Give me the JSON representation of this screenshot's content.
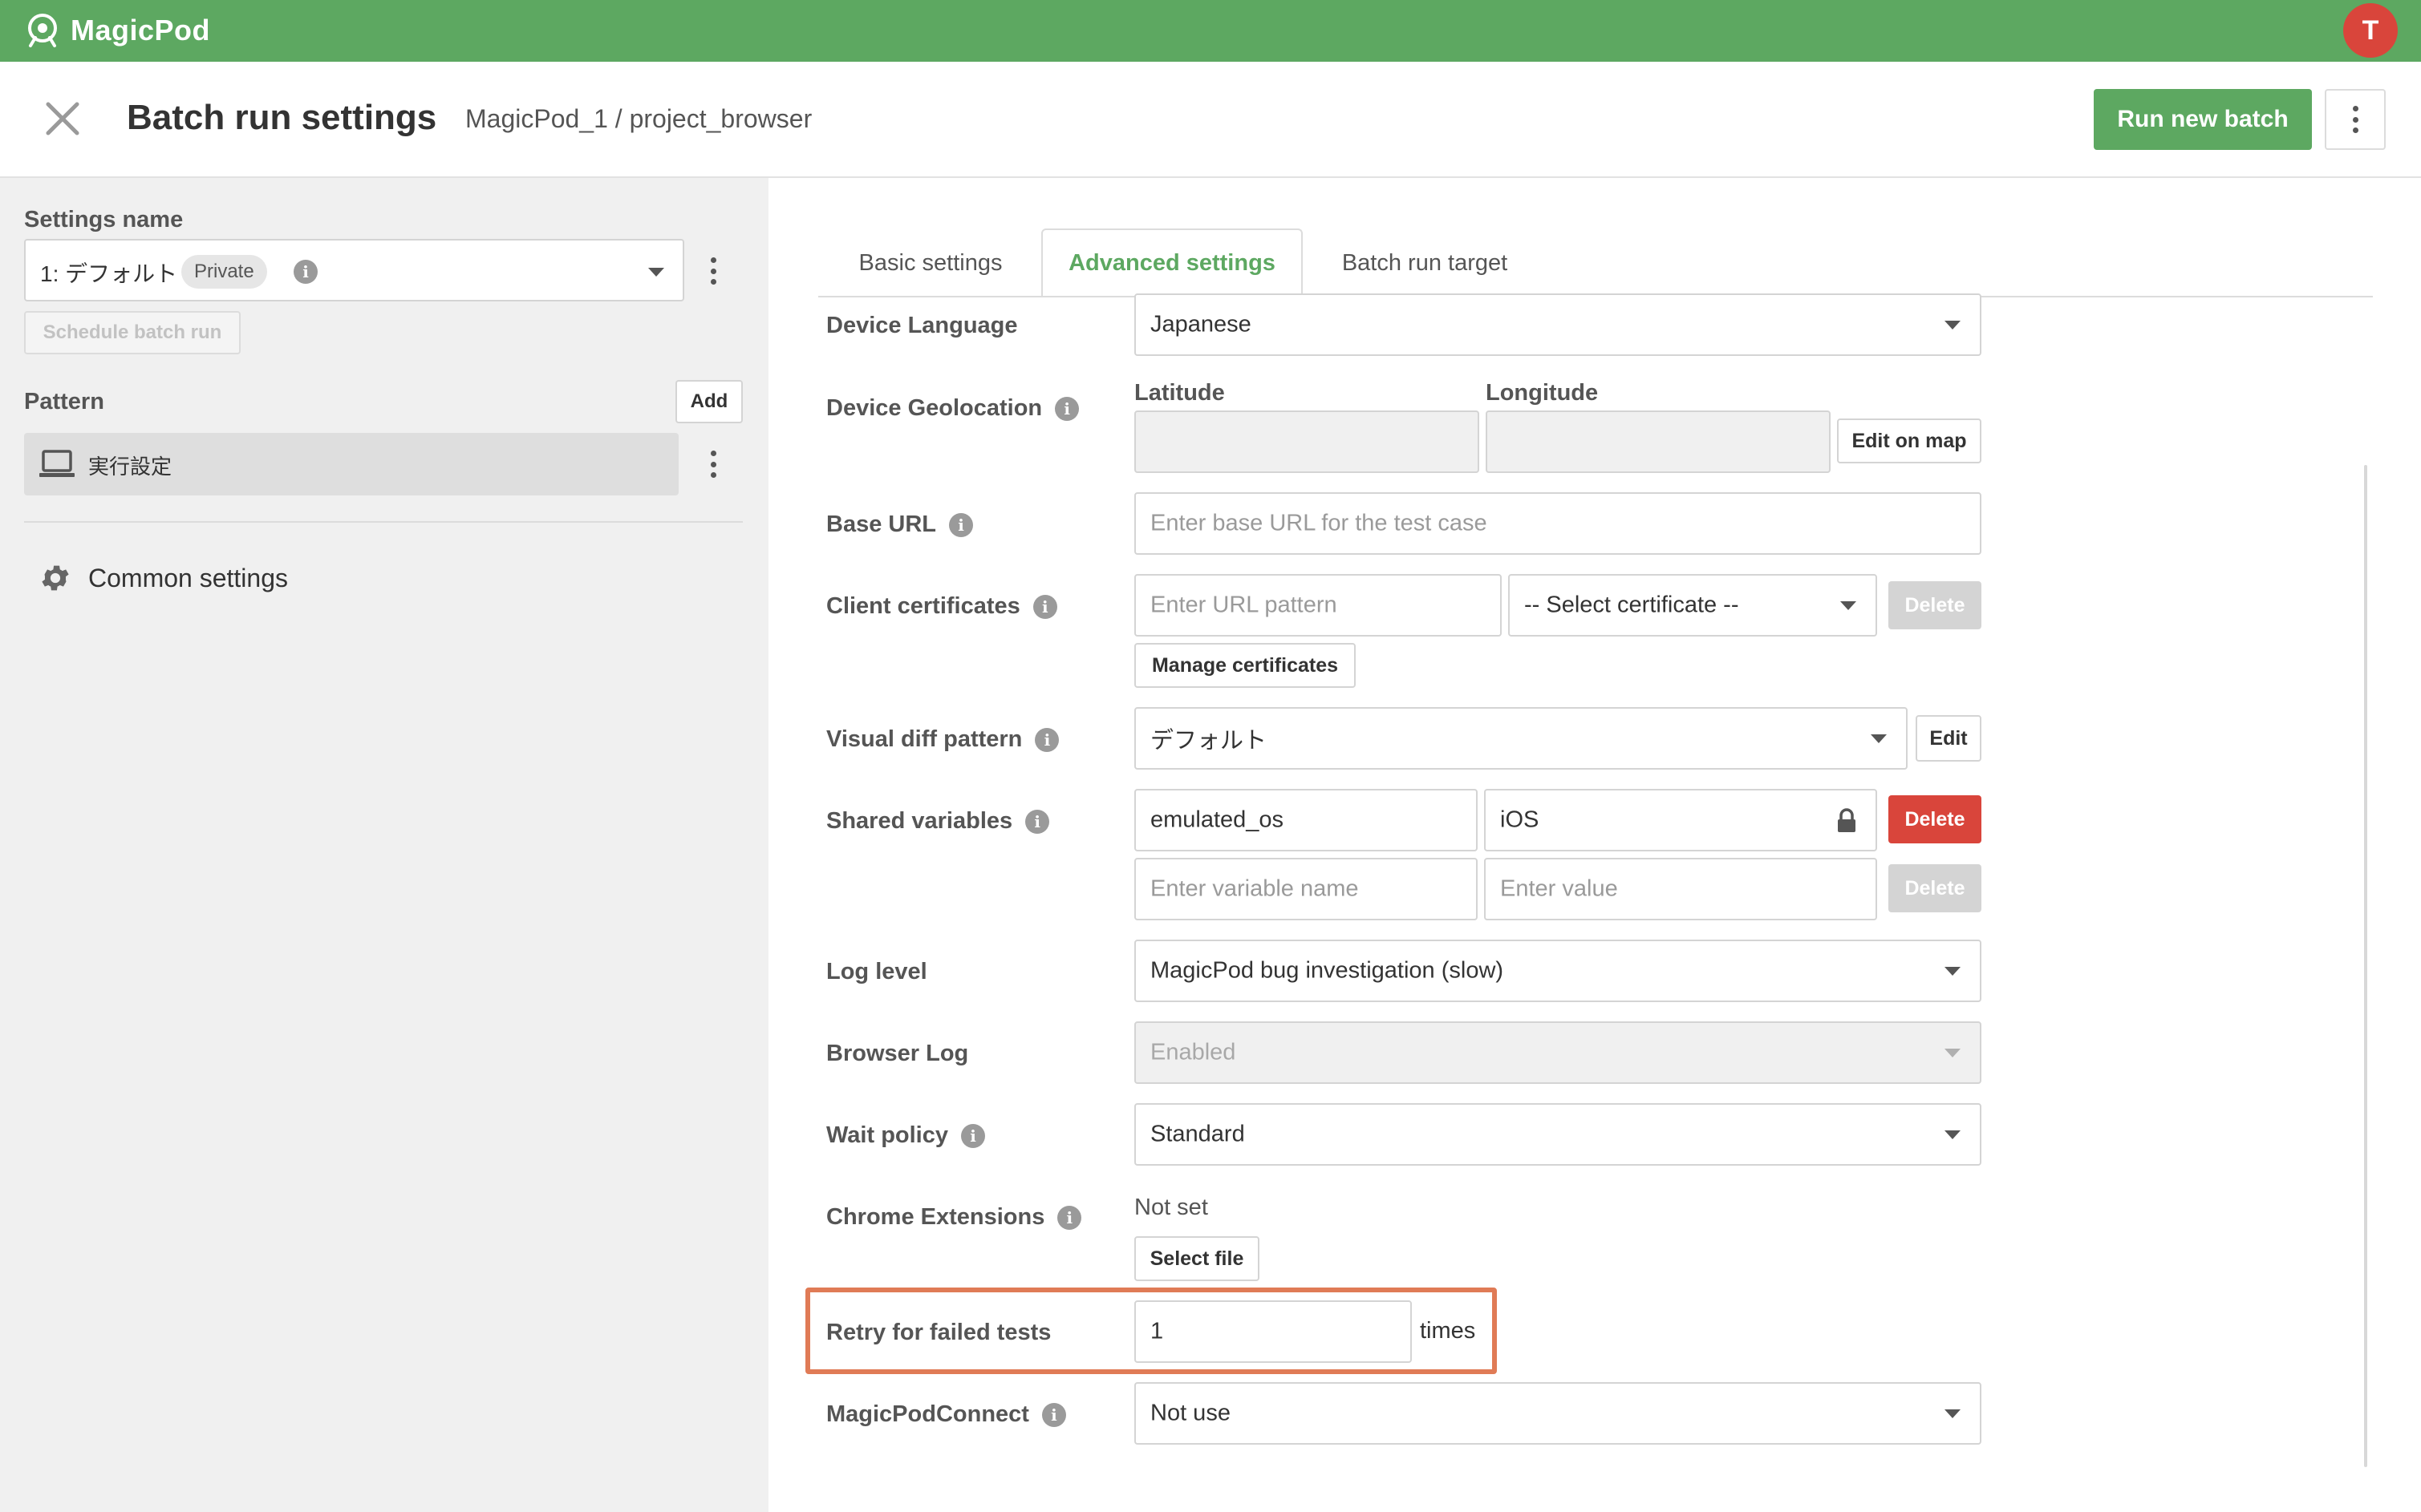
{
  "brand": {
    "name": "MagicPod",
    "color": "#5da861"
  },
  "user": {
    "avatar_initial": "T",
    "avatar_color": "#d9453b"
  },
  "header": {
    "title": "Batch run settings",
    "breadcrumb": "MagicPod_1 / project_browser",
    "run_button": "Run new batch"
  },
  "sidebar": {
    "settings_name_label": "Settings name",
    "settings_name_value": "1: デフォルト",
    "settings_badge": "Private",
    "schedule_button": "Schedule batch run",
    "pattern_label": "Pattern",
    "add_button": "Add",
    "pattern_item": "実行設定",
    "common_settings": "Common settings"
  },
  "tabs": [
    {
      "label": "Basic settings",
      "active": false
    },
    {
      "label": "Advanced settings",
      "active": true
    },
    {
      "label": "Batch run target",
      "active": false
    }
  ],
  "form": {
    "device_language": {
      "label": "Device Language",
      "value": "Japanese"
    },
    "device_geolocation": {
      "label": "Device Geolocation",
      "latitude_label": "Latitude",
      "longitude_label": "Longitude",
      "latitude_value": "",
      "longitude_value": "",
      "edit_button": "Edit on map"
    },
    "base_url": {
      "label": "Base URL",
      "placeholder": "Enter base URL for the test case"
    },
    "client_certificates": {
      "label": "Client certificates",
      "url_placeholder": "Enter URL pattern",
      "select_value": "-- Select certificate --",
      "delete_button": "Delete",
      "manage_button": "Manage certificates"
    },
    "visual_diff": {
      "label": "Visual diff pattern",
      "value": "デフォルト",
      "edit_button": "Edit"
    },
    "shared_variables": {
      "label": "Shared variables",
      "rows": [
        {
          "name": "emulated_os",
          "value": "iOS",
          "delete": "Delete"
        }
      ],
      "name_placeholder": "Enter variable name",
      "value_placeholder": "Enter value",
      "delete_button": "Delete"
    },
    "log_level": {
      "label": "Log level",
      "value": "MagicPod bug investigation (slow)"
    },
    "browser_log": {
      "label": "Browser Log",
      "value": "Enabled"
    },
    "wait_policy": {
      "label": "Wait policy",
      "value": "Standard"
    },
    "chrome_extensions": {
      "label": "Chrome Extensions",
      "status": "Not set",
      "select_button": "Select file"
    },
    "retry": {
      "label": "Retry for failed tests",
      "value": "1",
      "unit": "times"
    },
    "magicpod_connect": {
      "label": "MagicPodConnect",
      "value": "Not use"
    }
  },
  "info_icon_glyph": "i",
  "highlight_color": "#e07b56"
}
